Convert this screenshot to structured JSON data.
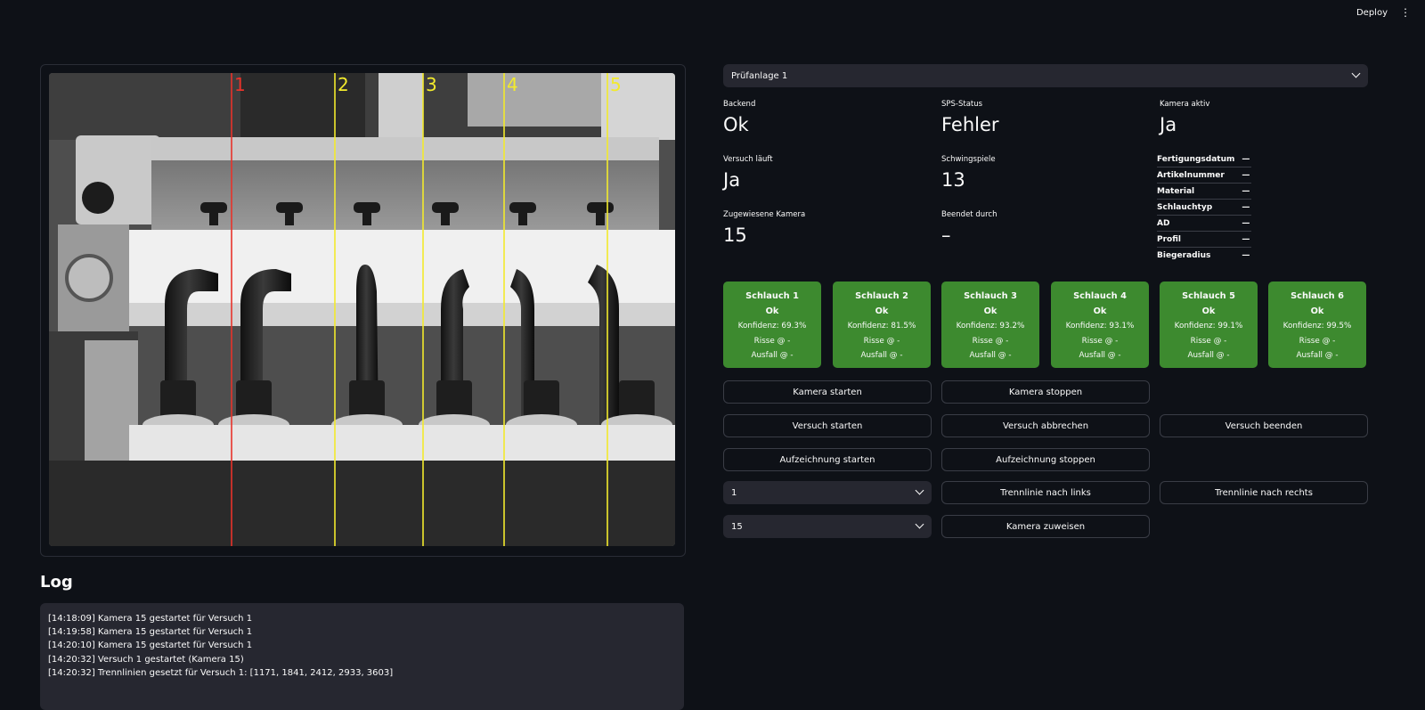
{
  "header": {
    "deploy_label": "Deploy",
    "menu_icon": "⋮"
  },
  "camera": {
    "image_label": "camera-feed",
    "divider_labels": [
      "1",
      "2",
      "3",
      "4",
      "5"
    ],
    "divider_colors": [
      "#e8332a",
      "#f2ea2c",
      "#f2ea2c",
      "#f2ea2c",
      "#f2ea2c"
    ]
  },
  "log": {
    "title": "Log",
    "lines": [
      "[14:18:09] Kamera 15 gestartet für Versuch 1",
      "[14:19:58] Kamera 15 gestartet für Versuch 1",
      "[14:20:10] Kamera 15 gestartet für Versuch 1",
      "[14:20:32] Versuch 1 gestartet (Kamera 15)",
      "[14:20:32] Trennlinien gesetzt für Versuch 1: [1171, 1841, 2412, 2933, 3603]"
    ]
  },
  "station_select": {
    "value": "Prüfanlage 1"
  },
  "metrics": {
    "backend": {
      "label": "Backend",
      "value": "Ok"
    },
    "sps": {
      "label": "SPS-Status",
      "value": "Fehler"
    },
    "camera_active": {
      "label": "Kamera aktiv",
      "value": "Ja"
    },
    "trial_running": {
      "label": "Versuch läuft",
      "value": "Ja"
    },
    "cycles": {
      "label": "Schwingspiele",
      "value": "13"
    },
    "assigned_camera": {
      "label": "Zugewiesene Kamera",
      "value": "15"
    },
    "ended_by": {
      "label": "Beendet durch",
      "value": "–"
    }
  },
  "info": [
    {
      "key": "Fertigungsdatum",
      "value": "—"
    },
    {
      "key": "Artikelnummer",
      "value": "—"
    },
    {
      "key": "Material",
      "value": "—"
    },
    {
      "key": "Schlauchtyp",
      "value": "—"
    },
    {
      "key": "AD",
      "value": "—"
    },
    {
      "key": "Profil",
      "value": "—"
    },
    {
      "key": "Biegeradius",
      "value": "—"
    }
  ],
  "hoses": [
    {
      "title": "Schlauch 1",
      "status": "Ok",
      "confidence": "Konfidenz: 69.3%",
      "cracks": "Risse @ -",
      "failure": "Ausfall @ -"
    },
    {
      "title": "Schlauch 2",
      "status": "Ok",
      "confidence": "Konfidenz: 81.5%",
      "cracks": "Risse @ -",
      "failure": "Ausfall @ -"
    },
    {
      "title": "Schlauch 3",
      "status": "Ok",
      "confidence": "Konfidenz: 93.2%",
      "cracks": "Risse @ -",
      "failure": "Ausfall @ -"
    },
    {
      "title": "Schlauch 4",
      "status": "Ok",
      "confidence": "Konfidenz: 93.1%",
      "cracks": "Risse @ -",
      "failure": "Ausfall @ -"
    },
    {
      "title": "Schlauch 5",
      "status": "Ok",
      "confidence": "Konfidenz: 99.1%",
      "cracks": "Risse @ -",
      "failure": "Ausfall @ -"
    },
    {
      "title": "Schlauch 6",
      "status": "Ok",
      "confidence": "Konfidenz: 99.5%",
      "cracks": "Risse @ -",
      "failure": "Ausfall @ -"
    }
  ],
  "buttons": {
    "camera_start": "Kamera starten",
    "camera_stop": "Kamera stoppen",
    "trial_start": "Versuch starten",
    "trial_abort": "Versuch abbrechen",
    "trial_end": "Versuch beenden",
    "rec_start": "Aufzeichnung starten",
    "rec_stop": "Aufzeichnung stoppen",
    "divider_left": "Trennlinie nach links",
    "divider_right": "Trennlinie nach rechts",
    "camera_assign": "Kamera zuweisen"
  },
  "divider_select": {
    "value": "1"
  },
  "camera_select": {
    "value": "15"
  },
  "colors": {
    "background": "#0e1117",
    "panel": "#262730",
    "hose_ok": "#3d8a2f"
  }
}
